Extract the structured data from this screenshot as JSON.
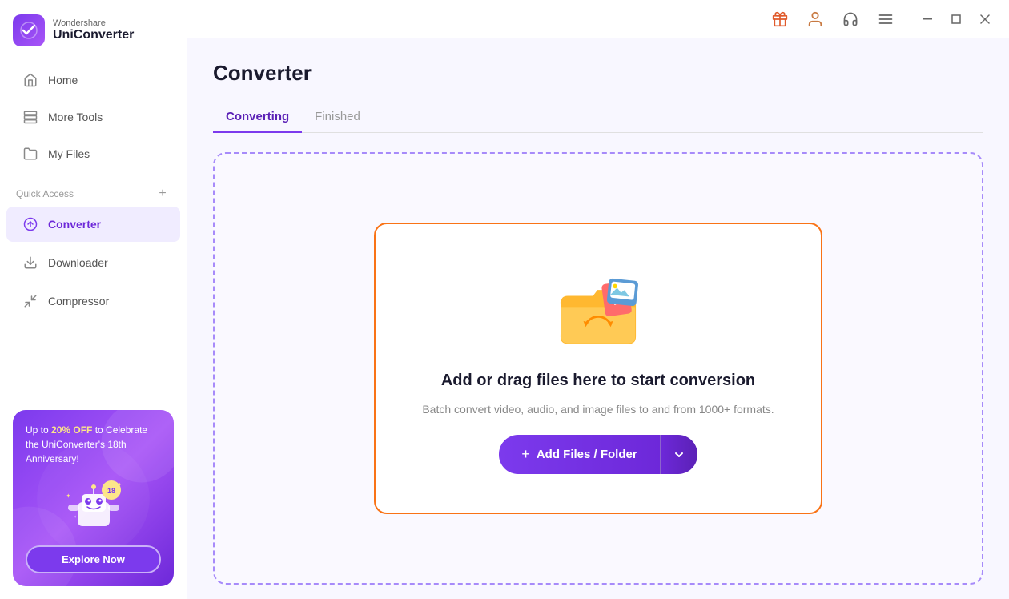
{
  "app": {
    "brand": "Wondershare",
    "name": "UniConverter"
  },
  "sidebar": {
    "nav_items": [
      {
        "id": "home",
        "label": "Home",
        "icon": "home-icon"
      },
      {
        "id": "more-tools",
        "label": "More Tools",
        "icon": "tools-icon"
      },
      {
        "id": "my-files",
        "label": "My Files",
        "icon": "files-icon"
      }
    ],
    "quick_access_label": "Quick Access",
    "quick_access_add": "+",
    "quick_access_items": [
      {
        "id": "converter",
        "label": "Converter",
        "icon": "converter-icon",
        "active": true
      },
      {
        "id": "downloader",
        "label": "Downloader",
        "icon": "downloader-icon"
      },
      {
        "id": "compressor",
        "label": "Compressor",
        "icon": "compressor-icon"
      }
    ],
    "promo": {
      "text_before": "Up to ",
      "highlight": "20% OFF",
      "text_after": " to Celebrate the UniConverter's 18th Anniversary!",
      "btn_label": "Explore Now"
    }
  },
  "titlebar": {
    "icons": [
      "gift-icon",
      "user-icon",
      "headset-icon",
      "menu-icon"
    ],
    "window_controls": [
      "minimize-icon",
      "maximize-icon",
      "close-icon"
    ]
  },
  "page": {
    "title": "Converter",
    "tabs": [
      {
        "id": "converting",
        "label": "Converting",
        "active": true
      },
      {
        "id": "finished",
        "label": "Finished",
        "active": false
      }
    ],
    "drop_zone": {
      "title": "Add or drag files here to start conversion",
      "subtitle": "Batch convert video, audio, and image files to and from 1000+ formats.",
      "btn_label": "Add Files / Folder",
      "btn_plus": "+"
    }
  }
}
